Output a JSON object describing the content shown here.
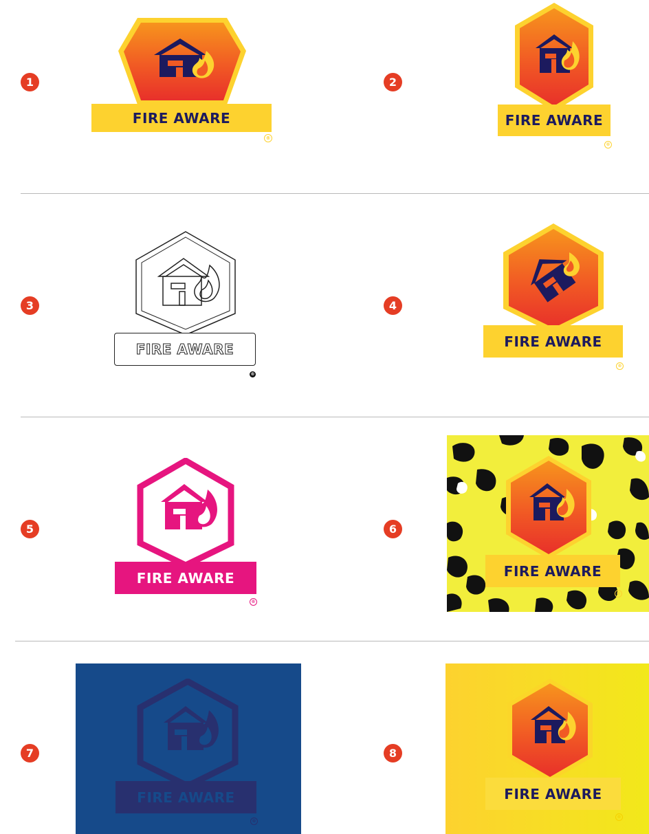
{
  "variants": [
    {
      "number": "1",
      "wordmark": "FIRE AWARE",
      "reg": "®"
    },
    {
      "number": "2",
      "wordmark": "FIRE AWARE",
      "reg": "®"
    },
    {
      "number": "3",
      "wordmark": "FIRE AWARE",
      "reg": "®"
    },
    {
      "number": "4",
      "wordmark": "FIRE AWARE",
      "reg": "®"
    },
    {
      "number": "5",
      "wordmark": "FIRE AWARE",
      "reg": "®"
    },
    {
      "number": "6",
      "wordmark": "FIRE AWARE",
      "reg": "®"
    },
    {
      "number": "7",
      "wordmark": "FIRE AWARE",
      "reg": "®"
    },
    {
      "number": "8",
      "wordmark": "FIRE AWARE",
      "reg": "®"
    }
  ],
  "colors": {
    "number_badge": "#e53d24",
    "brand_navy": "#1c1a5e",
    "brand_orange": "#f15a24",
    "brand_yellow": "#fdd22f",
    "magenta": "#e6157f",
    "blue_bg": "#164a8a",
    "leopard_bg": "#f2ee3c"
  },
  "icons": [
    "hexagon-badge-icon",
    "house-icon",
    "flame-icon",
    "leopard-pattern"
  ]
}
